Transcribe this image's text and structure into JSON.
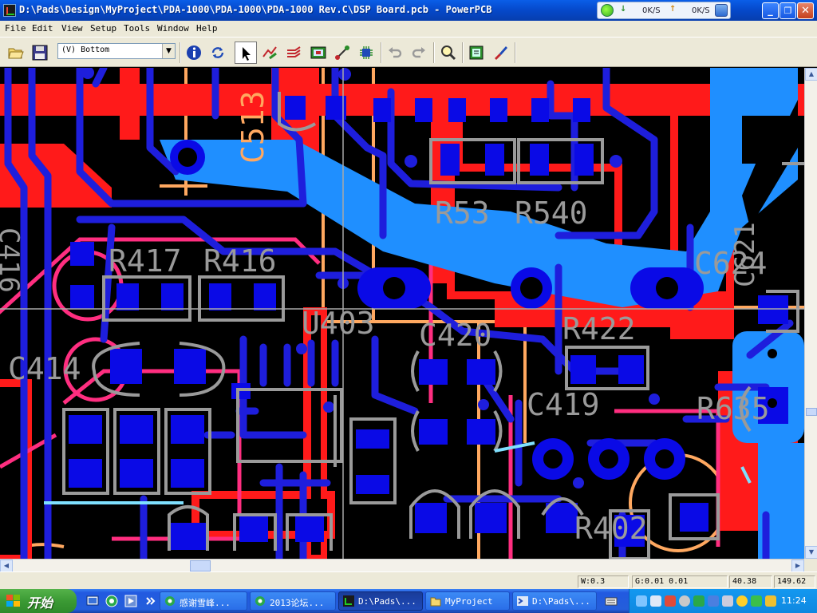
{
  "window": {
    "title": "D:\\Pads\\Design\\MyProject\\PDA-1000\\PDA-1000\\PDA-1000 Rev.C\\DSP Board.pcb - PowerPCB",
    "min_label": "_",
    "max_label": "❐",
    "close_label": "✕"
  },
  "netmeter": {
    "down_arrow": "↓",
    "down_value": "0K/S",
    "up_arrow": "↑",
    "up_value": "0K/S"
  },
  "menu": [
    "File",
    "Edit",
    "View",
    "Setup",
    "Tools",
    "Window",
    "Help"
  ],
  "toolbar": {
    "layer_value": "(V) Bottom",
    "buttons": [
      "open-file",
      "save",
      "info",
      "refresh",
      "select-pointer",
      "route",
      "auto-route",
      "drc",
      "connect",
      "design-verify",
      "undo",
      "redo",
      "zoom",
      "report",
      "cam"
    ]
  },
  "pcb": {
    "labels": [
      "C513",
      "R53",
      "R540",
      "R417",
      "R416",
      "C416",
      "C414",
      "U403",
      "C420",
      "R422",
      "C419",
      "C624",
      "R635",
      "C621",
      "R402"
    ]
  },
  "scroll": {
    "up": "▲",
    "down": "▼",
    "left": "◀",
    "right": "▶"
  },
  "status": {
    "width": "W:0.3",
    "grid": "G:0.01 0.01",
    "x": "40.38",
    "y": "149.62"
  },
  "taskbar": {
    "start_label": "开始",
    "tasks": [
      {
        "label": "感谢雪峰..."
      },
      {
        "label": "2013论坛..."
      },
      {
        "label": "D:\\Pads\\..."
      },
      {
        "label": "MyProject"
      },
      {
        "label": "D:\\Pads\\..."
      }
    ],
    "clock": "11:24"
  },
  "colors": {
    "trace_blue": "#1e1edc",
    "pour_blue": "#1f8fff",
    "trace_red": "#ff1a1a",
    "outline_magenta": "#ff2e80",
    "silkscreen_gray": "#9a9a9a",
    "board_orange": "#ffa860"
  }
}
